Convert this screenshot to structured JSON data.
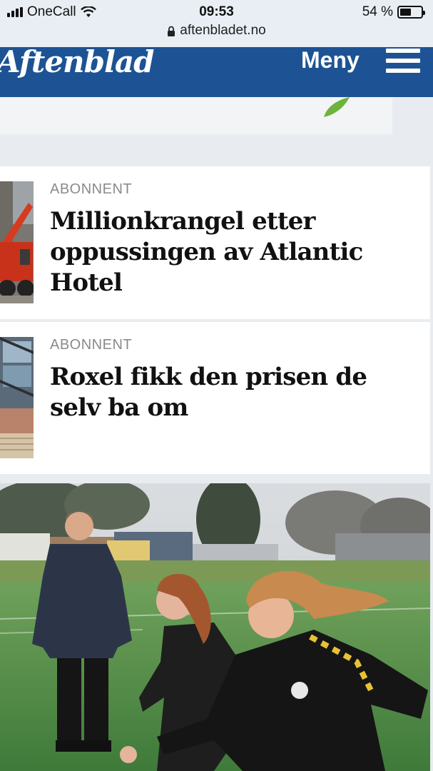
{
  "status_bar": {
    "carrier": "OneCall",
    "time": "09:53",
    "battery": "54 %",
    "battery_level": 0.54,
    "url": "aftenbladet.no"
  },
  "header": {
    "logo": "Aftenblad",
    "menu_label": "Meny"
  },
  "articles": [
    {
      "tag": "ABONNENT",
      "headline": "Millionkrangel etter oppussingen av Atlantic Hotel"
    },
    {
      "tag": "ABONNENT",
      "headline": "Roxel fikk den prisen de selv ba om"
    }
  ],
  "colors": {
    "header_bg": "#1d5394",
    "page_bg": "#e8ecf1",
    "tag_text": "#8a8a8a"
  },
  "icons": [
    "signal-icon",
    "wifi-icon",
    "battery-icon",
    "lock-icon",
    "menu-icon"
  ]
}
